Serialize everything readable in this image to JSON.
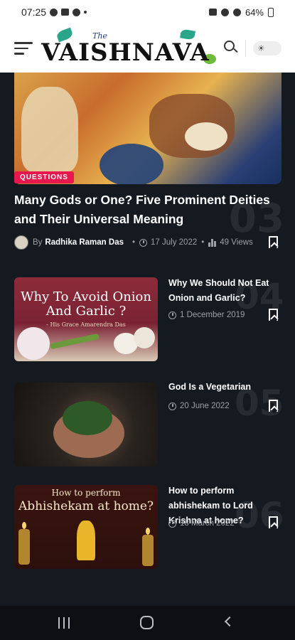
{
  "status_bar": {
    "time": "07:25",
    "battery": "64%"
  },
  "header": {
    "logo_the": "The",
    "logo_text": "VAISHNAVA"
  },
  "hero": {
    "category": "QUESTIONS",
    "title": "Many Gods or One? Five Prominent Deities and Their Universal Meaning",
    "number": "03",
    "by_label": "By",
    "author": "Radhika Raman Das",
    "date": "17 July 2022",
    "views": "49 Views"
  },
  "posts": [
    {
      "title": "Why We Should Not Eat Onion and Garlic?",
      "date": "1 December 2019",
      "number": "04",
      "image_title": "Why To Avoid Onion And Garlic ?",
      "image_subtitle": "- His Grace Amarendra Das"
    },
    {
      "title": "God Is a Vegetarian",
      "date": "20 June 2022",
      "number": "05"
    },
    {
      "title": "How to perform abhishekam to Lord Krishna at home?",
      "date": "18 March 2022",
      "number": "06",
      "image_title_line1": "How to perform",
      "image_title_line2": "Abhishekam at home?"
    }
  ],
  "colors": {
    "accent": "#e8174e",
    "background": "#151a21",
    "meta": "#9aa0a8"
  }
}
